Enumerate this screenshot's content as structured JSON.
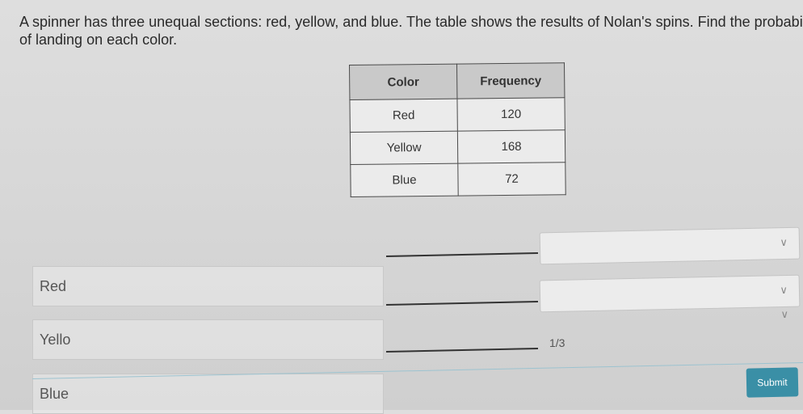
{
  "question": {
    "line1": "A spinner has three unequal sections: red, yellow, and blue. The table shows the results of Nolan's spins. Find the probabilit",
    "line2": "of landing on each color."
  },
  "table": {
    "headers": [
      "Color",
      "Frequency"
    ],
    "rows": [
      {
        "color": "Red",
        "frequency": "120"
      },
      {
        "color": "Yellow",
        "frequency": "168"
      },
      {
        "color": "Blue",
        "frequency": "72"
      }
    ]
  },
  "answers": [
    {
      "label": "Red",
      "value": ""
    },
    {
      "label": "Yello",
      "value": ""
    },
    {
      "label": "Blue",
      "value": "1/3"
    }
  ],
  "dropdown_icon": "chevron-down-icon",
  "submit_label": "Submit",
  "colors": {
    "submit_bg": "#3a8fa6",
    "table_header_bg": "#c9c9c9"
  }
}
